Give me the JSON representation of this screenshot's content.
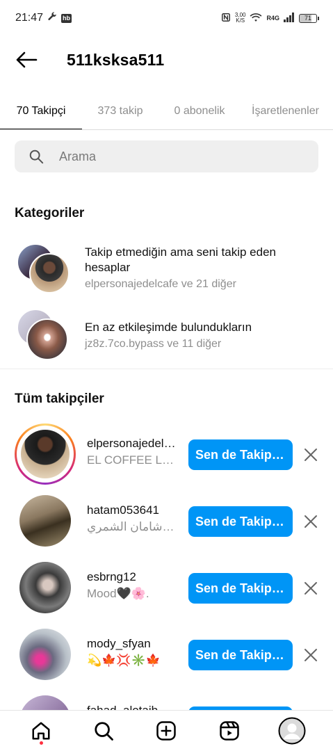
{
  "status_bar": {
    "time": "21:47",
    "app_badge": "hb",
    "network_speed_value": "3,00",
    "network_speed_unit": "K/S",
    "network_type": "R4G",
    "battery": "71"
  },
  "header": {
    "title": "511ksksa511"
  },
  "tabs": [
    {
      "label": "70 Takipçi"
    },
    {
      "label": "373 takip"
    },
    {
      "label": "0 abonelik"
    },
    {
      "label": "İşaretlenenler"
    }
  ],
  "search": {
    "placeholder": "Arama"
  },
  "categories_section": {
    "heading": "Kategoriler",
    "items": [
      {
        "title": "Takip etmediğin ama seni takip eden hesaplar",
        "subtitle": "elpersonajedelcafe ve 21 diğer"
      },
      {
        "title": "En az etkileşimde bulundukların",
        "subtitle": "jz8z.7co.bypass ve 11 diğer"
      }
    ]
  },
  "followers_section": {
    "heading": "Tüm takipçiler",
    "follow_label": "Sen de Takip Et",
    "rows": [
      {
        "username": "elpersonajedelcafe",
        "fullname": "EL COFFEE LAB",
        "has_story": true
      },
      {
        "username": "hatam053641",
        "fullname": "ابو شامان الشمري",
        "has_story": false
      },
      {
        "username": "esbrng12",
        "fullname": "Mood🖤🌸.",
        "has_story": false
      },
      {
        "username": "mody_sfyan",
        "fullname": "💫🍁💢✳️🍁",
        "has_story": false
      },
      {
        "username": "fahad_alotaib",
        "fullname": "",
        "has_story": false
      }
    ]
  },
  "bottom_nav": {
    "items": [
      "home-icon",
      "search-icon",
      "create-icon",
      "reels-icon",
      "profile-icon"
    ]
  }
}
